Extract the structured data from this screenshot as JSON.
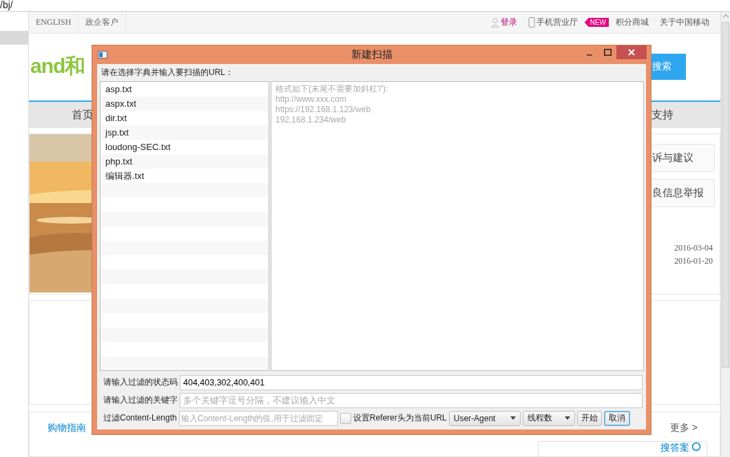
{
  "browser": {
    "address": "/bj/"
  },
  "site": {
    "top_links_left": [
      "ENGLISH",
      "政企客户"
    ],
    "top_links_right": [
      {
        "kind": "login",
        "label": "登录"
      },
      {
        "kind": "phone",
        "label": "手机营业厅"
      },
      {
        "kind": "badge",
        "label": "NEW"
      },
      {
        "kind": "plain",
        "label": "积分商城"
      },
      {
        "kind": "plain",
        "label": "关于中国移动"
      }
    ],
    "logo": "and和",
    "search_button": "搜索",
    "nav": [
      "首页",
      "支持"
    ],
    "side_links": [
      "诉与建议",
      "良信息举报"
    ],
    "dates": [
      "2016-03-04",
      "2016-01-20"
    ],
    "shopping_guide": "购物指南",
    "more": "更多 >",
    "answer_search": "搜答案"
  },
  "dialog": {
    "title": "新建扫描",
    "prompt": "请在选择字典并输入要扫描的URL：",
    "dictionaries": [
      {
        "name": "asp.txt",
        "selected": false
      },
      {
        "name": "aspx.txt",
        "selected": false
      },
      {
        "name": "dir.txt",
        "selected": false
      },
      {
        "name": "jsp.txt",
        "selected": false
      },
      {
        "name": "loudong-SEC.txt",
        "selected": false
      },
      {
        "name": "php.txt",
        "selected": false
      },
      {
        "name": "编辑器.txt",
        "selected": false
      }
    ],
    "url_field": {
      "placeholder": "格式如下(末尾不需要加斜杠'/'):\nhttp://www.xxx.com\nhttps://192.168.1.123/web\n192.168.1.234/web"
    },
    "status_codes": {
      "label": "请输入过滤的状态码",
      "value": "404,403,302,400,401"
    },
    "keywords": {
      "label": "请输入过滤的关键字",
      "placeholder": "多个关键字逗号分隔，不建议输入中文"
    },
    "content_length": {
      "label": "过滤Content-Length",
      "placeholder": "输入Content-Length的值,用于过滤固定"
    },
    "referer": {
      "label": "设置Referer头为当前URL",
      "checked": false
    },
    "dropdowns": [
      "User-Agent",
      "线程数"
    ],
    "buttons": [
      {
        "label": "开始",
        "focused": false
      },
      {
        "label": "取消",
        "focused": true
      }
    ]
  }
}
